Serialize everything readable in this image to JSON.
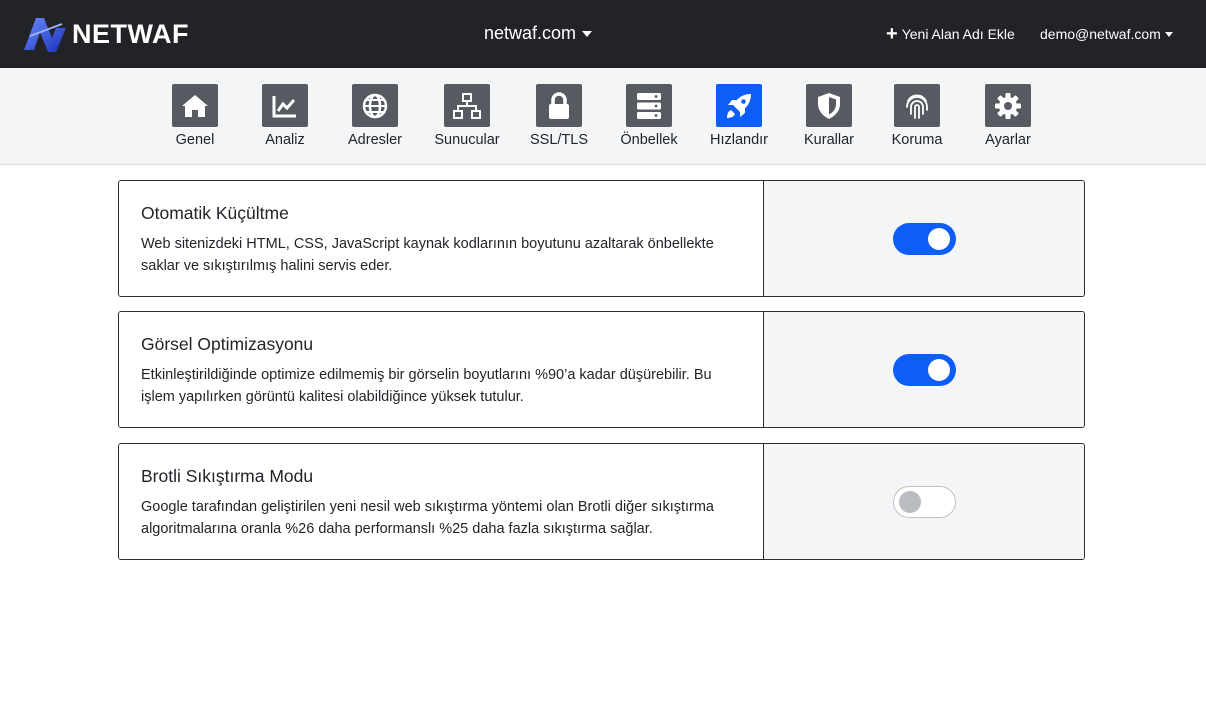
{
  "header": {
    "logo_text": "NETWAF",
    "domain": "netwaf.com",
    "add_domain_label": "Yeni Alan Adı Ekle",
    "user_email": "demo@netwaf.com"
  },
  "nav": {
    "items": [
      {
        "label": "Genel",
        "icon": "home-icon"
      },
      {
        "label": "Analiz",
        "icon": "chart-line-icon"
      },
      {
        "label": "Adresler",
        "icon": "globe-icon"
      },
      {
        "label": "Sunucular",
        "icon": "network-icon"
      },
      {
        "label": "SSL/TLS",
        "icon": "lock-icon"
      },
      {
        "label": "Önbellek",
        "icon": "server-icon"
      },
      {
        "label": "Hızlandır",
        "icon": "rocket-icon"
      },
      {
        "label": "Kurallar",
        "icon": "shield-icon"
      },
      {
        "label": "Koruma",
        "icon": "fingerprint-icon"
      },
      {
        "label": "Ayarlar",
        "icon": "gear-icon"
      }
    ],
    "active": "Hızlandır"
  },
  "settings": [
    {
      "title": "Otomatik Küçültme",
      "description": "Web sitenizdeki HTML, CSS, JavaScript kaynak kodlarının boyutunu azaltarak önbellekte saklar ve sıkıştırılmış halini servis eder.",
      "enabled": true
    },
    {
      "title": "Görsel Optimizasyonu",
      "description": "Etkinleştirildiğinde optimize edilmemiş bir görselin boyutlarını %90’a kadar düşürebilir. Bu işlem yapılırken görüntü kalitesi olabildiğince yüksek tutulur.",
      "enabled": true
    },
    {
      "title": "Brotli Sıkıştırma Modu",
      "description": "Google tarafından geliştirilen yeni nesil web sıkıştırma yöntemi olan Brotli diğer sıkıştırma algoritmalarına oranla %26 daha performanslı %25 daha fazla sıkıştırma sağlar.",
      "enabled": false
    }
  ],
  "colors": {
    "accent": "#0d5ef8",
    "topbar": "#212327",
    "nav_icon": "#565b62"
  }
}
